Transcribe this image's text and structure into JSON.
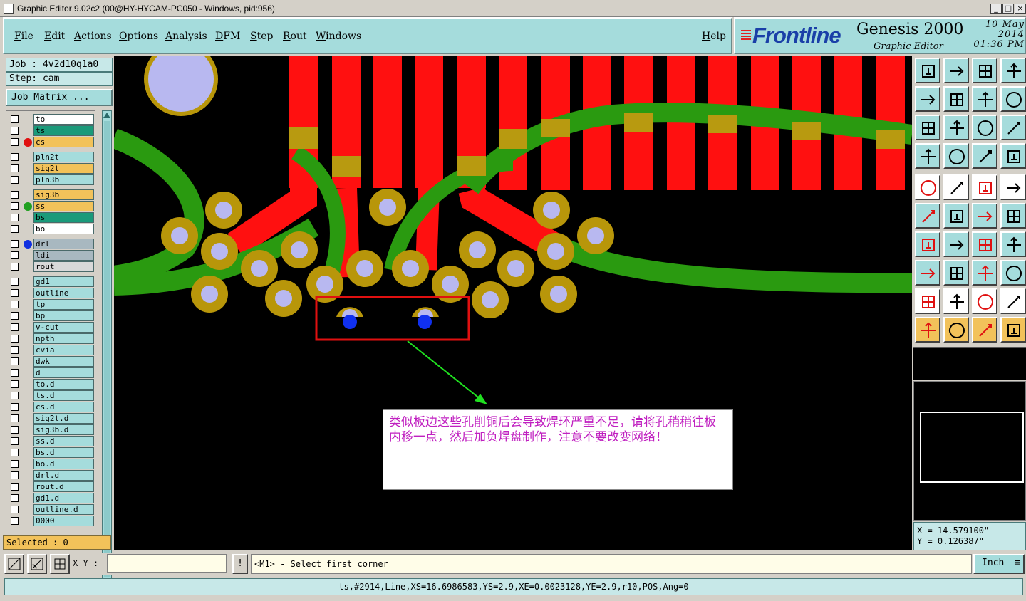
{
  "window": {
    "title": "Graphic Editor 9.02c2 (00@HY-HYCAM-PC050 - Windows, pid:956)",
    "min": "_",
    "max": "□",
    "close": "×"
  },
  "menu": {
    "file": "File",
    "edit": "Edit",
    "actions": "Actions",
    "options": "Options",
    "analysis": "Analysis",
    "dfm": "DFM",
    "step": "Step",
    "rout": "Rout",
    "windows": "Windows",
    "help": "Help"
  },
  "brand": {
    "logo": "Frontline",
    "product": "Genesis 2000",
    "subtitle": "Graphic Editor",
    "date": "10 May 2014",
    "time": "01:36 PM"
  },
  "job": {
    "job_line": "Job : 4v2d10q1a0",
    "step_line": "Step: cam",
    "matrix_button": "Job Matrix ..."
  },
  "layers": [
    {
      "name": "to",
      "color": "#ffffff",
      "marker": ""
    },
    {
      "name": "ts",
      "color": "#1a9a7a",
      "marker": ""
    },
    {
      "name": "cs",
      "color": "#f2c25a",
      "marker": "#e01010"
    },
    {
      "name": "pln2t",
      "color": "#a5dcdc",
      "marker": ""
    },
    {
      "name": "sig2t",
      "color": "#f2c25a",
      "marker": ""
    },
    {
      "name": "pln3b",
      "color": "#a5dcdc",
      "marker": ""
    },
    {
      "name": "sig3b",
      "color": "#f2c25a",
      "marker": ""
    },
    {
      "name": "ss",
      "color": "#f2c25a",
      "marker": "#20a020"
    },
    {
      "name": "bs",
      "color": "#1a9a7a",
      "marker": ""
    },
    {
      "name": "bo",
      "color": "#ffffff",
      "marker": ""
    },
    {
      "name": "drl",
      "color": "#a8b8c0",
      "marker": "#1030e0"
    },
    {
      "name": "ldi",
      "color": "#a8b8c0",
      "marker": ""
    },
    {
      "name": "rout",
      "color": "#d8d8d8",
      "marker": ""
    },
    {
      "name": "gd1",
      "color": "#a5dcdc",
      "marker": ""
    },
    {
      "name": "outline",
      "color": "#a5dcdc",
      "marker": ""
    },
    {
      "name": "tp",
      "color": "#a5dcdc",
      "marker": ""
    },
    {
      "name": "bp",
      "color": "#a5dcdc",
      "marker": ""
    },
    {
      "name": "v-cut",
      "color": "#a5dcdc",
      "marker": ""
    },
    {
      "name": "npth",
      "color": "#a5dcdc",
      "marker": ""
    },
    {
      "name": "cvia",
      "color": "#a5dcdc",
      "marker": ""
    },
    {
      "name": "dwk",
      "color": "#a5dcdc",
      "marker": ""
    },
    {
      "name": "d",
      "color": "#a5dcdc",
      "marker": ""
    },
    {
      "name": "to.d",
      "color": "#a5dcdc",
      "marker": ""
    },
    {
      "name": "ts.d",
      "color": "#a5dcdc",
      "marker": ""
    },
    {
      "name": "cs.d",
      "color": "#a5dcdc",
      "marker": ""
    },
    {
      "name": "sig2t.d",
      "color": "#a5dcdc",
      "marker": ""
    },
    {
      "name": "sig3b.d",
      "color": "#a5dcdc",
      "marker": ""
    },
    {
      "name": "ss.d",
      "color": "#a5dcdc",
      "marker": ""
    },
    {
      "name": "bs.d",
      "color": "#a5dcdc",
      "marker": ""
    },
    {
      "name": "bo.d",
      "color": "#a5dcdc",
      "marker": ""
    },
    {
      "name": "drl.d",
      "color": "#a5dcdc",
      "marker": ""
    },
    {
      "name": "rout.d",
      "color": "#a5dcdc",
      "marker": ""
    },
    {
      "name": "gd1.d",
      "color": "#a5dcdc",
      "marker": ""
    },
    {
      "name": "outline.d",
      "color": "#a5dcdc",
      "marker": ""
    },
    {
      "name": "0000",
      "color": "#a5dcdc",
      "marker": ""
    }
  ],
  "selected": "Selected : 0",
  "note": "类似板边这些孔削铜后会导致焊环严重不足，请将孔稍稍往板内移一点，然后加负焊盘制作，注意不要改变网络！",
  "coords": {
    "x": "X = 14.579100\"",
    "y": "Y = 0.126387\""
  },
  "cmd": {
    "xy_label": "X Y :",
    "xy_value": "",
    "bang": "!",
    "prompt": "<M1> - Select first corner",
    "units": "Inch"
  },
  "status": "ts,#2914,Line,XS=16.6986583,YS=2.9,XE=0.0023128,YE=2.9,r10,POS,Ang=0",
  "colors": {
    "trace_red": "#ff1010",
    "pad_gold": "#b8960a",
    "hole": "#b8b8f0",
    "trace_green": "#2a9a10",
    "overlap": "#b89a10",
    "drill_blue": "#1030f0"
  }
}
